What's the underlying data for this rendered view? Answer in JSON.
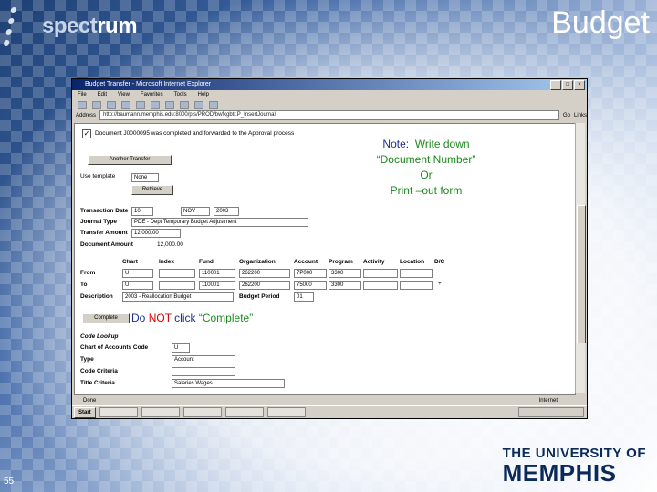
{
  "slide": {
    "title": "Budget",
    "logo_text_a": "spect",
    "logo_text_b": "rum",
    "page_number": "55",
    "university_line1": "THE UNIVERSITY OF",
    "university_line2": "MEMPHIS"
  },
  "window": {
    "title": "Budget Transfer - Microsoft Internet Explorer",
    "menu": [
      "File",
      "Edit",
      "View",
      "Favorites",
      "Tools",
      "Help"
    ],
    "address_label": "Address",
    "address": "http://baumann.memphis.edu:8000/pls/PROD/bwfkgbtr.P_InsertJournal",
    "go_label": "Go",
    "links_label": "Links",
    "status": "Done",
    "zone": "Internet",
    "start_label": "Start"
  },
  "form": {
    "message": "Document J0000095 was completed and forwarded to the Approval process",
    "another_button": "Another Transfer",
    "use_template_label": "Use template",
    "template_value": "None",
    "retrieve_button": "Retrieve",
    "transaction_date_label": "Transaction Date",
    "date_day": "10",
    "date_month": "NOV",
    "date_year": "2003",
    "journal_type_label": "Journal Type",
    "journal_type_value": "PDE - Dept Temporary Budget Adjustment",
    "transfer_amount_label": "Transfer Amount",
    "transfer_amount_value": "12,000.00",
    "document_amount_label": "Document Amount",
    "document_amount_value": "12,000.00",
    "headers": [
      "Chart",
      "Index",
      "Fund",
      "Organization",
      "Account",
      "Program",
      "Activity",
      "Location",
      "D/C"
    ],
    "rows": [
      {
        "label": "From",
        "chart": "U",
        "index": "",
        "fund": "110001",
        "org": "262200",
        "account": "7P000",
        "program": "3300",
        "activity": "",
        "location": "",
        "dc": "-"
      },
      {
        "label": "To",
        "chart": "U",
        "index": "",
        "fund": "110001",
        "org": "262200",
        "account": "75000",
        "program": "3300",
        "activity": "",
        "location": "",
        "dc": "+"
      }
    ],
    "description_label": "Description",
    "description_value": "2003 - Reallocation Budget",
    "budget_period_label": "Budget Period",
    "budget_period_value": "01",
    "complete_button": "Complete",
    "code_lookup_label": "Code Lookup",
    "chart_label": "Chart of Accounts Code",
    "chart_value": "U",
    "type_label": "Type",
    "type_value": "Account",
    "code_criteria_label": "Code Criteria",
    "title_criteria_label": "Title Criteria",
    "title_criteria_value": "Salaries Wages"
  },
  "annotations": {
    "note_line1_a": "Note:",
    "note_line1_b": "Write down",
    "note_line2": "“Document Number”",
    "note_line3": "Or",
    "note_line4": "Print –out form",
    "warn_a": "Do",
    "warn_b": "NOT",
    "warn_c": "click",
    "warn_d": "“Complete”"
  },
  "colors": {
    "note": "#1c8a1c",
    "emphasis_red": "#d80000",
    "emphasis_blue": "#1c2f90",
    "title_bar": "#0a246a"
  }
}
